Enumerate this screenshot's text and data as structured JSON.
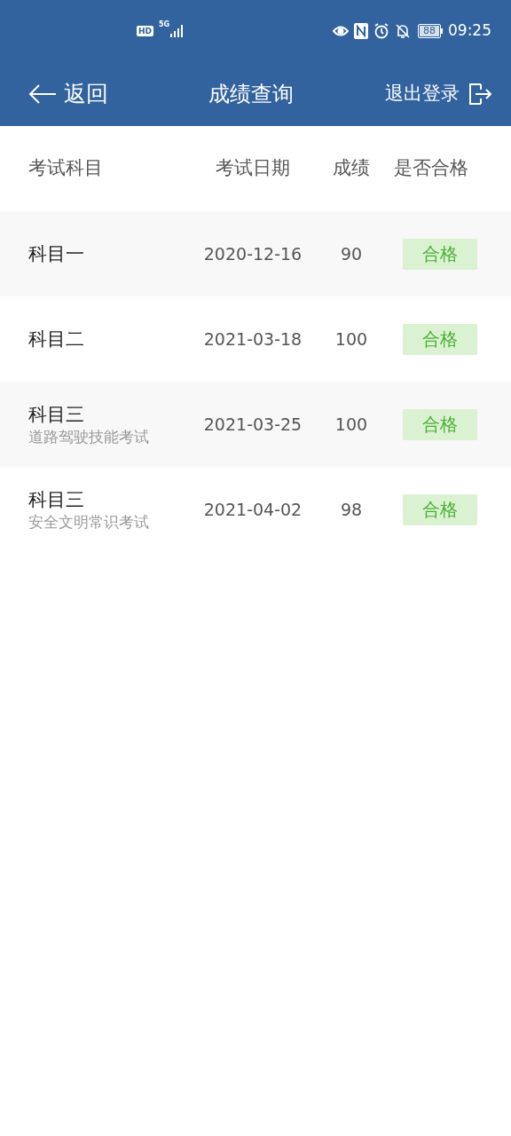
{
  "status_bar": {
    "hd": "HD",
    "network": "5G",
    "battery": "88",
    "time": "09:25"
  },
  "header": {
    "back": "返回",
    "title": "成绩查询",
    "logout": "退出登录"
  },
  "table": {
    "columns": [
      "考试科目",
      "考试日期",
      "成绩",
      "是否合格"
    ],
    "rows": [
      {
        "subject": "科目一",
        "date": "2020-12-16",
        "score": "90",
        "result": {
          "text": "合格",
          "kind": "pass"
        }
      },
      {
        "subject": "科目二",
        "date": "2021-03-18",
        "score": "100",
        "result": {
          "text": "合格",
          "kind": "pass"
        }
      },
      {
        "subject": "科目三",
        "subtitle": "道路驾驶技能考试",
        "date": "2021-03-25",
        "score": "100",
        "result": {
          "text": "合格",
          "kind": "pass"
        }
      },
      {
        "subject": "科目三",
        "subtitle": "安全文明常识考试",
        "date": "2021-04-02",
        "score": "98",
        "result": {
          "text": "合格",
          "kind": "pass"
        }
      }
    ]
  }
}
